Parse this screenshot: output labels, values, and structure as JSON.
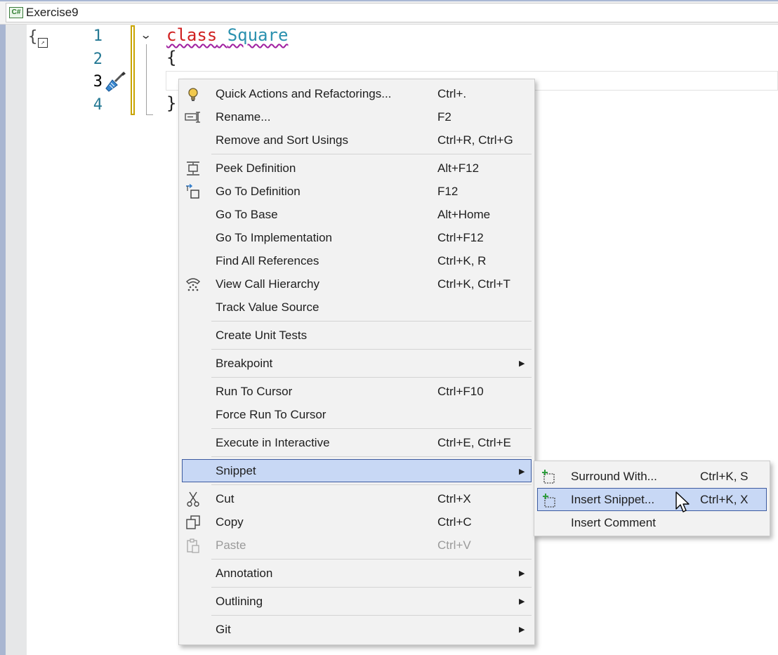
{
  "file_tab": {
    "icon": "csharp-file-icon",
    "icon_text": "C#",
    "name": "Exercise9"
  },
  "editor": {
    "line_numbers": [
      "1",
      "2",
      "3",
      "4"
    ],
    "code": {
      "line1_kw": "class",
      "line1_type": "Square",
      "line2": "{",
      "line4": "}"
    }
  },
  "context_menu": {
    "items": [
      {
        "label": "Quick Actions and Refactorings...",
        "shortcut": "Ctrl+.",
        "icon": "lightbulb-icon"
      },
      {
        "label": "Rename...",
        "shortcut": "F2",
        "icon": "rename-icon"
      },
      {
        "label": "Remove and Sort Usings",
        "shortcut": "Ctrl+R, Ctrl+G"
      },
      {
        "label": "Peek Definition",
        "shortcut": "Alt+F12",
        "icon": "peek-definition-icon"
      },
      {
        "label": "Go To Definition",
        "shortcut": "F12",
        "icon": "go-to-definition-icon"
      },
      {
        "label": "Go To Base",
        "shortcut": "Alt+Home"
      },
      {
        "label": "Go To Implementation",
        "shortcut": "Ctrl+F12"
      },
      {
        "label": "Find All References",
        "shortcut": "Ctrl+K, R"
      },
      {
        "label": "View Call Hierarchy",
        "shortcut": "Ctrl+K, Ctrl+T",
        "icon": "call-hierarchy-icon"
      },
      {
        "label": "Track Value Source",
        "shortcut": ""
      },
      {
        "label": "Create Unit Tests",
        "shortcut": ""
      },
      {
        "label": "Breakpoint",
        "shortcut": ""
      },
      {
        "label": "Run To Cursor",
        "shortcut": "Ctrl+F10"
      },
      {
        "label": "Force Run To Cursor",
        "shortcut": ""
      },
      {
        "label": "Execute in Interactive",
        "shortcut": "Ctrl+E, Ctrl+E"
      },
      {
        "label": "Snippet",
        "shortcut": ""
      },
      {
        "label": "Cut",
        "shortcut": "Ctrl+X",
        "icon": "scissors-icon"
      },
      {
        "label": "Copy",
        "shortcut": "Ctrl+C",
        "icon": "copy-icon"
      },
      {
        "label": "Paste",
        "shortcut": "Ctrl+V",
        "icon": "paste-icon"
      },
      {
        "label": "Annotation",
        "shortcut": ""
      },
      {
        "label": "Outlining",
        "shortcut": ""
      },
      {
        "label": "Git",
        "shortcut": ""
      }
    ]
  },
  "snippet_submenu": {
    "items": [
      {
        "label": "Surround With...",
        "shortcut": "Ctrl+K, S",
        "icon": "surround-with-icon"
      },
      {
        "label": "Insert Snippet...",
        "shortcut": "Ctrl+K, X",
        "icon": "insert-snippet-icon"
      },
      {
        "label": "Insert Comment",
        "shortcut": ""
      }
    ]
  },
  "colors": {
    "menu_bg": "#f2f2f2",
    "highlight_bg": "#c8d8f5",
    "highlight_border": "#3d5ba0",
    "keyword": "#d02020",
    "type_name": "#2b91af"
  }
}
